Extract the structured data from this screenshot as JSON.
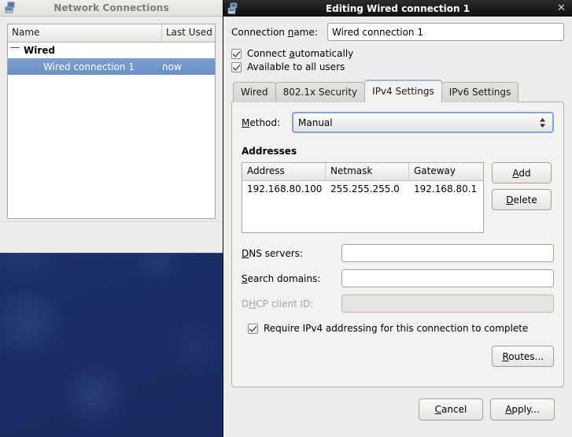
{
  "desktop": {
    "background_color": "#1b2f69"
  },
  "netconn_window": {
    "title": "Network Connections",
    "icon": "network-computers-icon",
    "columns": [
      {
        "label": "Name"
      },
      {
        "label": "Last Used"
      }
    ],
    "groups": [
      {
        "label": "Wired",
        "expanded": true,
        "rows": [
          {
            "name": "Wired connection 1",
            "last_used": "now",
            "selected": true
          }
        ]
      }
    ]
  },
  "dialog": {
    "title": "Editing Wired connection 1",
    "icon": "network-computers-icon",
    "close_label": "✕",
    "connection_name": {
      "label_pre": "Connection ",
      "label_mnemonic": "n",
      "label_post": "ame:",
      "value": "Wired connection 1"
    },
    "checkboxes": [
      {
        "name": "connect-automatically",
        "pre": "Connect ",
        "mnemonic": "a",
        "post": "utomatically",
        "checked": true
      },
      {
        "name": "available-to-all-users",
        "pre": "Available to all users",
        "mnemonic": "",
        "post": "",
        "checked": true
      }
    ],
    "tabs": [
      {
        "label": "Wired",
        "active": false
      },
      {
        "label": "802.1x Security",
        "active": false
      },
      {
        "label": "IPv4 Settings",
        "active": true
      },
      {
        "label": "IPv6 Settings",
        "active": false
      }
    ],
    "ipv4": {
      "method": {
        "label_pre": "",
        "label_mnemonic": "M",
        "label_post": "ethod:",
        "selected": "Manual"
      },
      "addresses_title": "Addresses",
      "address_columns": [
        "Address",
        "Netmask",
        "Gateway"
      ],
      "address_rows": [
        {
          "address": "192.168.80.100",
          "netmask": "255.255.255.0",
          "gateway": "192.168.80.1"
        }
      ],
      "add_button": {
        "pre": "",
        "mnemonic": "A",
        "post": "dd"
      },
      "delete_button": {
        "pre": "",
        "mnemonic": "D",
        "post": "elete"
      },
      "dns_servers": {
        "pre": "",
        "mnemonic": "D",
        "post": "NS servers:",
        "value": "",
        "placeholder": ""
      },
      "search_domains": {
        "pre": "",
        "mnemonic": "S",
        "post": "earch domains:",
        "value": "",
        "placeholder": ""
      },
      "dhcp_client_id": {
        "pre": "D",
        "mnemonic": "H",
        "post": "CP client ID:",
        "value": "",
        "placeholder": "",
        "disabled": true
      },
      "require_ipv4": {
        "label": "Require IPv4 addressing for this connection to complete",
        "checked": true
      },
      "routes_button": {
        "pre": "",
        "mnemonic": "R",
        "post": "outes..."
      }
    },
    "actions": {
      "cancel": {
        "pre": "",
        "mnemonic": "C",
        "post": "ancel"
      },
      "apply": {
        "pre": "",
        "mnemonic": "A",
        "post": "pply..."
      }
    }
  }
}
